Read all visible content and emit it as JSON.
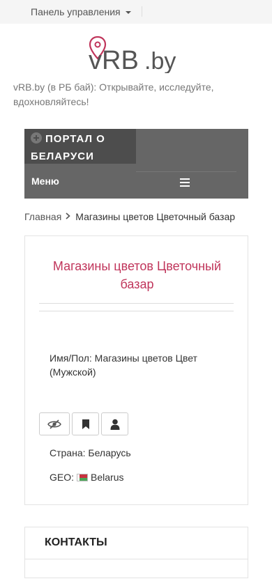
{
  "topbar": {
    "menu_label": "Панель управления"
  },
  "logo": {
    "brand_main": "vRB",
    "brand_suffix": ".by",
    "colors": {
      "pin": "#c0355b",
      "text": "#555555"
    }
  },
  "tagline": "vRB.by (в РБ бай): Открывайте, исследуйте, вдохновляйтесь!",
  "portal": {
    "title": "ПОРТАЛ О БЕЛАРУСИ",
    "menu_label": "Меню",
    "menu_icon": "hamburger-icon"
  },
  "breadcrumb": {
    "home": "Главная",
    "separator_icon": "chevron-right-icon",
    "current": "Магазины цветов Цветочный базар"
  },
  "entry": {
    "title": "Магазины цветов Цветочный базар",
    "name_line": "Имя/Пол: Магазины цветов Цвет (Мужской)",
    "actions": [
      {
        "icon": "eye-slash-icon"
      },
      {
        "icon": "bookmark-icon"
      },
      {
        "icon": "user-icon"
      }
    ],
    "country": "Страна: Беларусь",
    "geo_label": "GEO:",
    "geo_value": "Belarus",
    "flag_colors": {
      "red": "#c8313e",
      "green": "#4aa657"
    }
  },
  "contacts": {
    "title": "КОНТАКТЫ"
  },
  "colors": {
    "accent": "#c0355b",
    "portal_bg": "#666666",
    "portal_title_bg": "#4d4d4d"
  }
}
